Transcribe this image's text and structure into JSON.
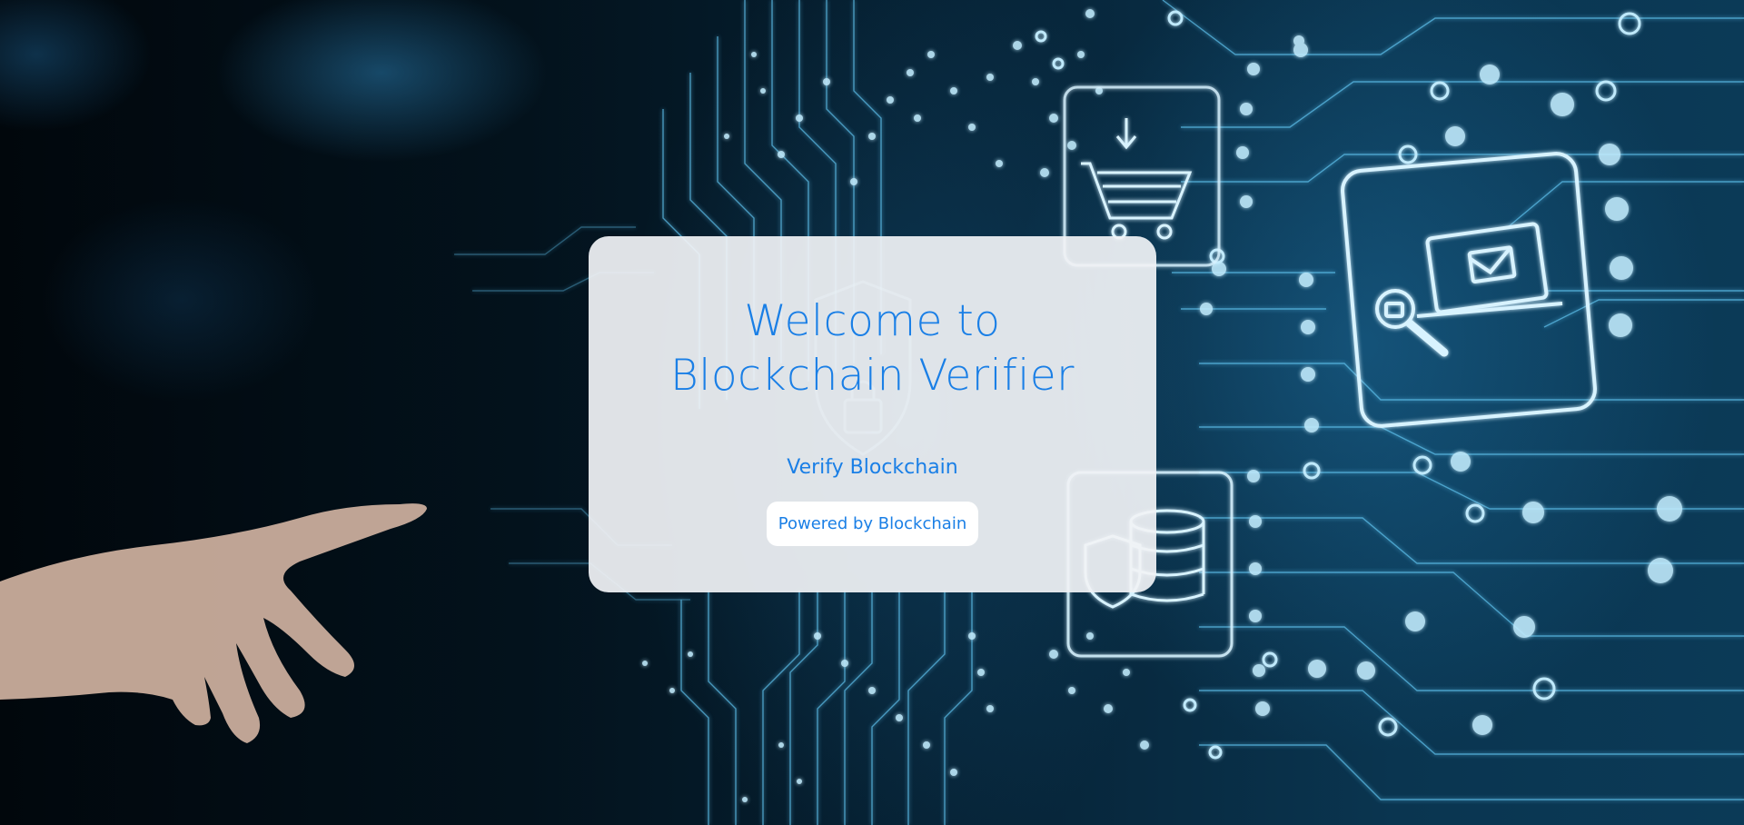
{
  "card": {
    "title_line1": "Welcome to",
    "title_line2": "Blockchain Verifier",
    "subtitle": "Verify Blockchain",
    "powered_by": "Powered by Blockchain"
  },
  "background": {
    "description_icons": [
      "shopping-cart-icon",
      "email-laptop-icon",
      "database-shield-icon",
      "padlock-icon",
      "shield-icon"
    ],
    "colors": {
      "circuit": "#7fd0f5",
      "dark": "#020910",
      "accent": "#1a7fe6"
    }
  }
}
